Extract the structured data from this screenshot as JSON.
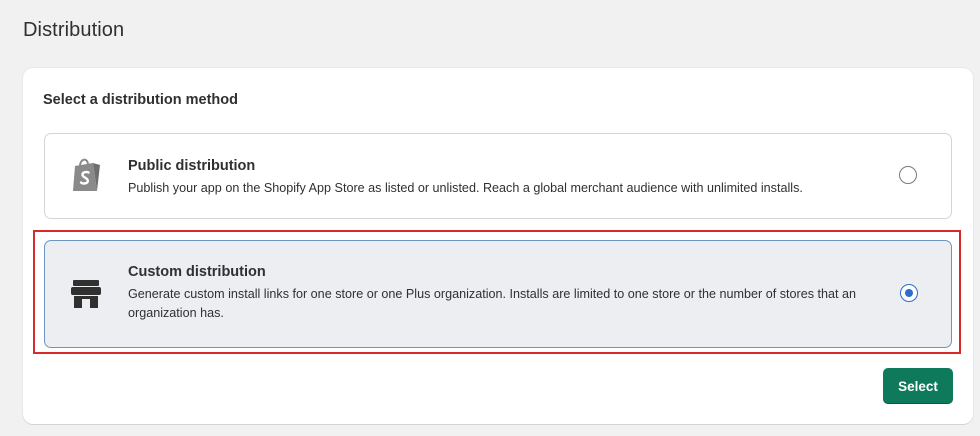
{
  "page": {
    "title": "Distribution"
  },
  "card": {
    "section_label": "Select a distribution method",
    "options": [
      {
        "id": "public",
        "title": "Public distribution",
        "description": "Publish your app on the Shopify App Store as listed or unlisted. Reach a global merchant audience with unlimited installs.",
        "icon": "shopify-bag-icon",
        "selected": false
      },
      {
        "id": "custom",
        "title": "Custom distribution",
        "description": "Generate custom install links for one store or one Plus organization. Installs are limited to one store or the number of stores that an organization has.",
        "icon": "store-icon",
        "selected": true
      }
    ],
    "select_label": "Select"
  },
  "colors": {
    "primary_button": "#0f7a5b",
    "selected_border": "#6d95c4",
    "selected_bg": "#eceef2",
    "radio_selected": "#2c6ecb",
    "highlight_outline": "#d62b2b"
  }
}
